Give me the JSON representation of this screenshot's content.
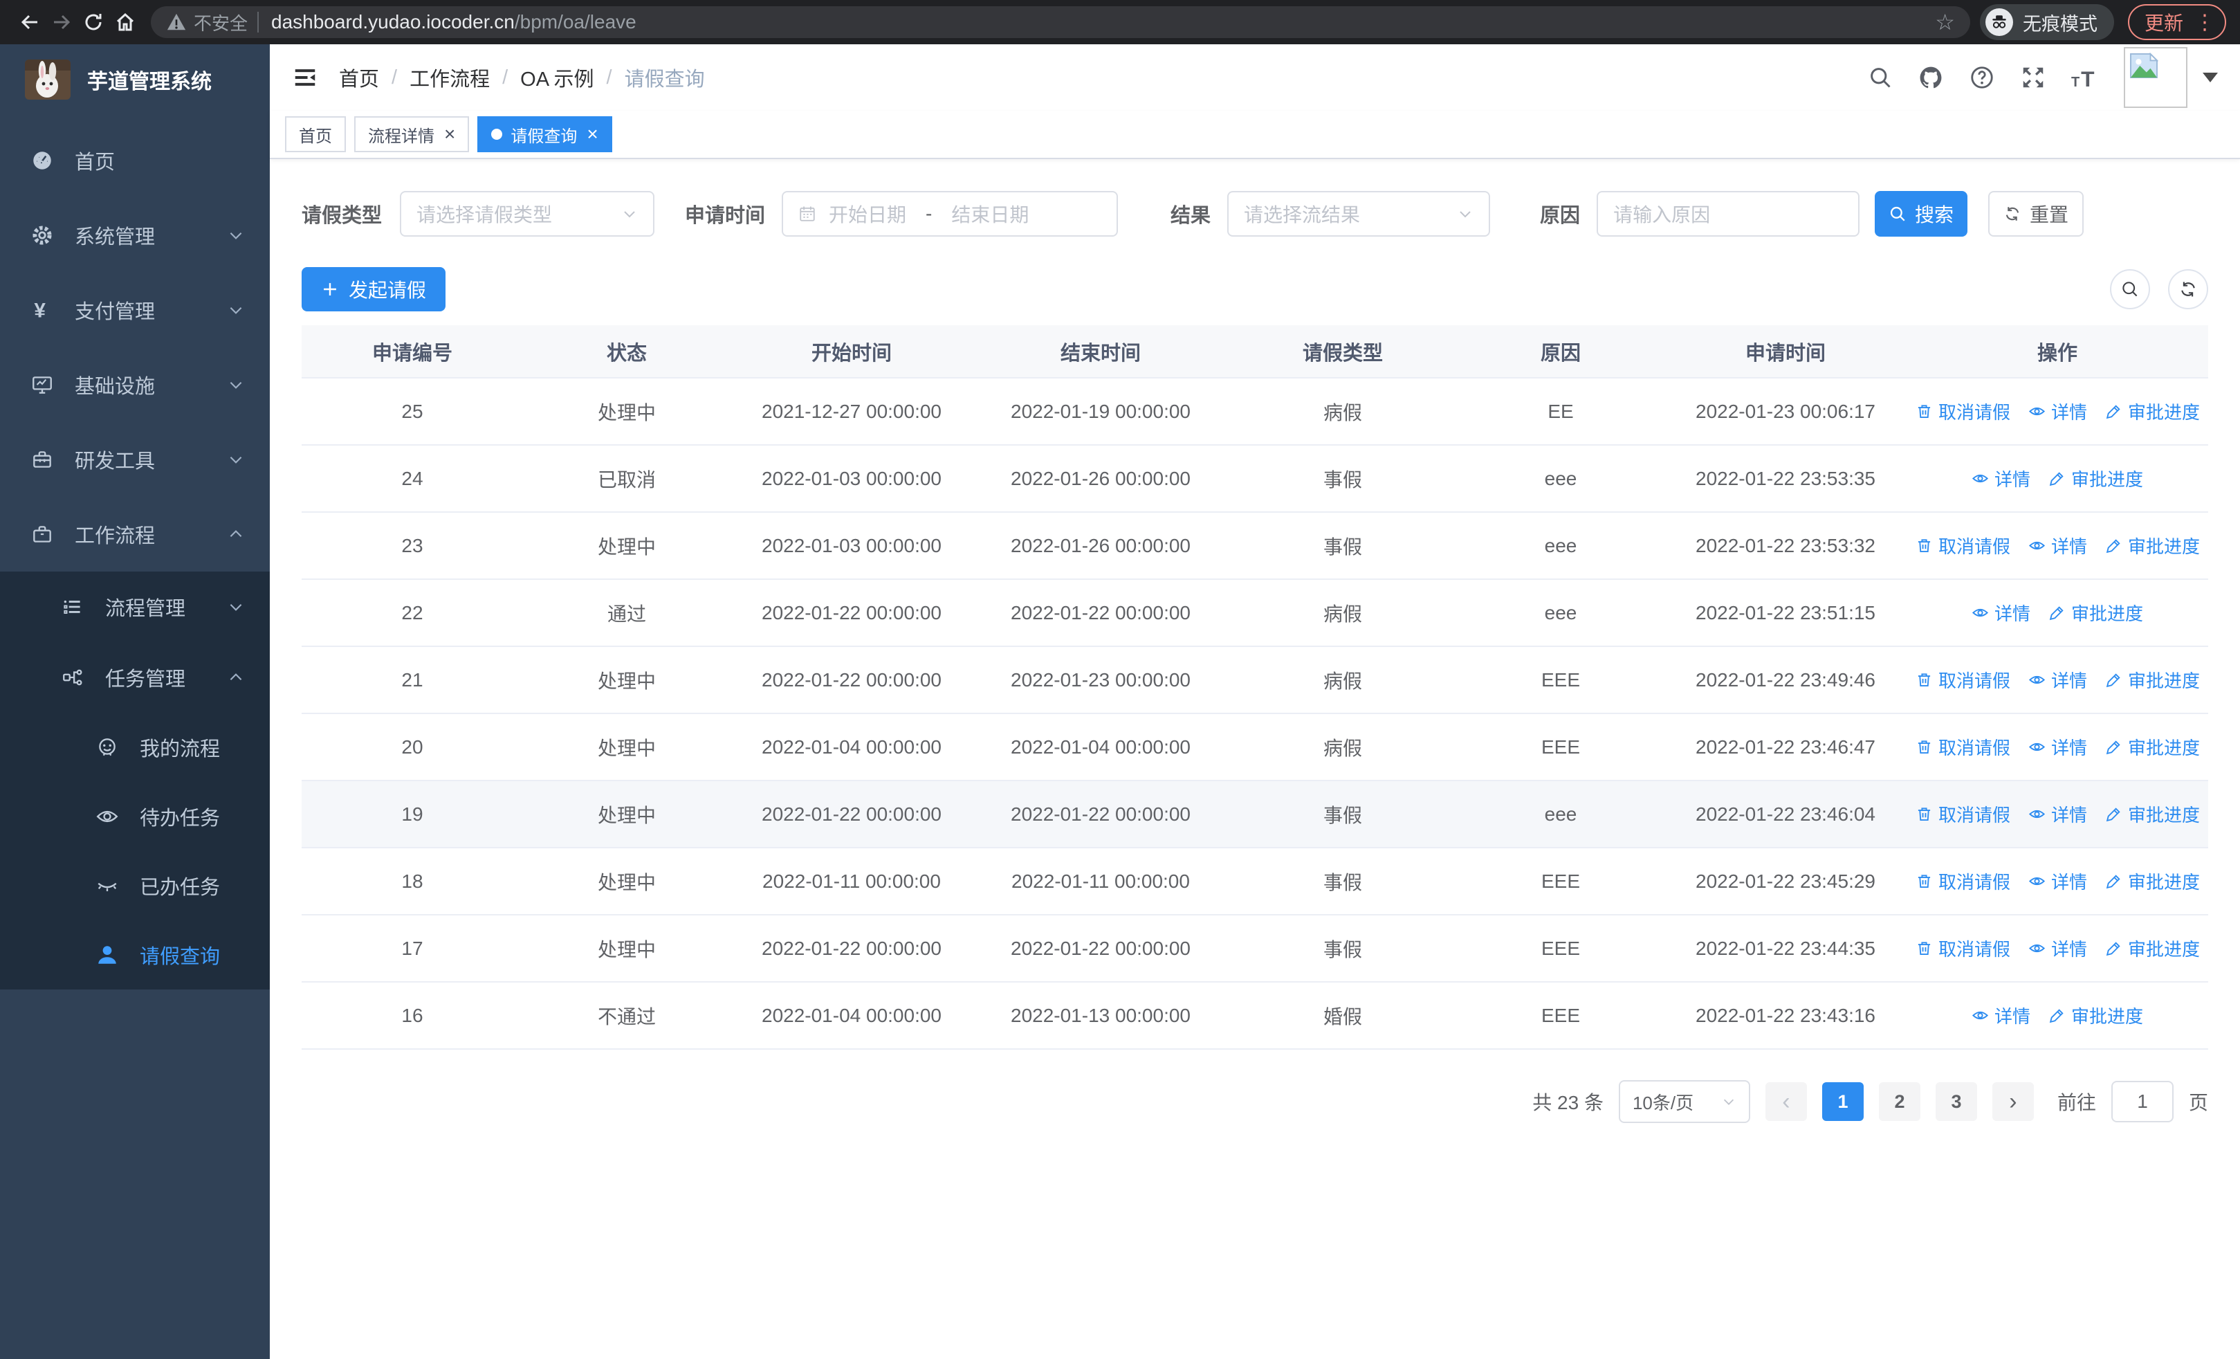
{
  "colors": {
    "primary": "#2d8cf0",
    "sidebar_bg": "#304156",
    "sidebar_sub_bg": "#1f2d3d",
    "sidebar_active": "#409eff",
    "chrome_update": "#f28b82",
    "table_header_bg": "#f7f8fa"
  },
  "browser": {
    "security_label": "不安全",
    "url_host": "dashboard.yudao.iocoder.cn",
    "url_path": "/bpm/oa/leave",
    "incognito_label": "无痕模式",
    "update_label": "更新",
    "menu_dots": "⋮",
    "star": "☆"
  },
  "sidebar": {
    "app_title": "芋道管理系统",
    "items": [
      {
        "label": "首页",
        "icon": "dashboard",
        "level": 1,
        "chev": "",
        "sub": false,
        "active": false
      },
      {
        "label": "系统管理",
        "icon": "gear",
        "level": 1,
        "chev": "down",
        "sub": false,
        "active": false
      },
      {
        "label": "支付管理",
        "icon": "yen",
        "level": 1,
        "chev": "down",
        "sub": false,
        "active": false
      },
      {
        "label": "基础设施",
        "icon": "monitor",
        "level": 1,
        "chev": "down",
        "sub": false,
        "active": false
      },
      {
        "label": "研发工具",
        "icon": "toolbox",
        "level": 1,
        "chev": "down",
        "sub": false,
        "active": false
      },
      {
        "label": "工作流程",
        "icon": "briefcase",
        "level": 1,
        "chev": "up",
        "sub": false,
        "active": false
      },
      {
        "label": "流程管理",
        "icon": "list",
        "level": 2,
        "chev": "down",
        "sub": true,
        "active": false
      },
      {
        "label": "任务管理",
        "icon": "tree",
        "level": 2,
        "chev": "up",
        "sub": true,
        "active": false
      },
      {
        "label": "我的流程",
        "icon": "face",
        "level": 3,
        "chev": "",
        "sub": true,
        "active": false
      },
      {
        "label": "待办任务",
        "icon": "eye-open",
        "level": 3,
        "chev": "",
        "sub": true,
        "active": false
      },
      {
        "label": "已办任务",
        "icon": "eye-closed",
        "level": 3,
        "chev": "",
        "sub": true,
        "active": false
      },
      {
        "label": "请假查询",
        "icon": "user",
        "level": 3,
        "chev": "",
        "sub": true,
        "active": true
      }
    ]
  },
  "header": {
    "breadcrumb": [
      "首页",
      "工作流程",
      "OA 示例",
      "请假查询"
    ]
  },
  "tabs": [
    {
      "label": "首页",
      "closable": false,
      "active": false
    },
    {
      "label": "流程详情",
      "closable": true,
      "active": false
    },
    {
      "label": "请假查询",
      "closable": true,
      "active": true
    }
  ],
  "filters": {
    "leave_type_label": "请假类型",
    "leave_type_placeholder": "请选择请假类型",
    "apply_time_label": "申请时间",
    "date_start_placeholder": "开始日期",
    "date_separator": "-",
    "date_end_placeholder": "结束日期",
    "result_label": "结果",
    "result_placeholder": "请选择流结果",
    "reason_label": "原因",
    "reason_placeholder": "请输入原因",
    "search_label": "搜索",
    "reset_label": "重置"
  },
  "toolbar": {
    "create_label": "发起请假"
  },
  "table": {
    "columns": [
      "申请编号",
      "状态",
      "开始时间",
      "结束时间",
      "请假类型",
      "原因",
      "申请时间",
      "操作"
    ],
    "action_labels": {
      "cancel": "取消请假",
      "detail": "详情",
      "progress": "审批进度"
    },
    "rows": [
      {
        "id": "25",
        "status": "处理中",
        "start": "2021-12-27 00:00:00",
        "end": "2022-01-19 00:00:00",
        "type": "病假",
        "reason": "EE",
        "applied": "2022-01-23 00:06:17",
        "actions": [
          "cancel",
          "detail",
          "progress"
        ],
        "highlight": false
      },
      {
        "id": "24",
        "status": "已取消",
        "start": "2022-01-03 00:00:00",
        "end": "2022-01-26 00:00:00",
        "type": "事假",
        "reason": "eee",
        "applied": "2022-01-22 23:53:35",
        "actions": [
          "detail",
          "progress"
        ],
        "highlight": false
      },
      {
        "id": "23",
        "status": "处理中",
        "start": "2022-01-03 00:00:00",
        "end": "2022-01-26 00:00:00",
        "type": "事假",
        "reason": "eee",
        "applied": "2022-01-22 23:53:32",
        "actions": [
          "cancel",
          "detail",
          "progress"
        ],
        "highlight": false
      },
      {
        "id": "22",
        "status": "通过",
        "start": "2022-01-22 00:00:00",
        "end": "2022-01-22 00:00:00",
        "type": "病假",
        "reason": "eee",
        "applied": "2022-01-22 23:51:15",
        "actions": [
          "detail",
          "progress"
        ],
        "highlight": false
      },
      {
        "id": "21",
        "status": "处理中",
        "start": "2022-01-22 00:00:00",
        "end": "2022-01-23 00:00:00",
        "type": "病假",
        "reason": "EEE",
        "applied": "2022-01-22 23:49:46",
        "actions": [
          "cancel",
          "detail",
          "progress"
        ],
        "highlight": false
      },
      {
        "id": "20",
        "status": "处理中",
        "start": "2022-01-04 00:00:00",
        "end": "2022-01-04 00:00:00",
        "type": "病假",
        "reason": "EEE",
        "applied": "2022-01-22 23:46:47",
        "actions": [
          "cancel",
          "detail",
          "progress"
        ],
        "highlight": false
      },
      {
        "id": "19",
        "status": "处理中",
        "start": "2022-01-22 00:00:00",
        "end": "2022-01-22 00:00:00",
        "type": "事假",
        "reason": "eee",
        "applied": "2022-01-22 23:46:04",
        "actions": [
          "cancel",
          "detail",
          "progress"
        ],
        "highlight": true
      },
      {
        "id": "18",
        "status": "处理中",
        "start": "2022-01-11 00:00:00",
        "end": "2022-01-11 00:00:00",
        "type": "事假",
        "reason": "EEE",
        "applied": "2022-01-22 23:45:29",
        "actions": [
          "cancel",
          "detail",
          "progress"
        ],
        "highlight": false
      },
      {
        "id": "17",
        "status": "处理中",
        "start": "2022-01-22 00:00:00",
        "end": "2022-01-22 00:00:00",
        "type": "事假",
        "reason": "EEE",
        "applied": "2022-01-22 23:44:35",
        "actions": [
          "cancel",
          "detail",
          "progress"
        ],
        "highlight": false
      },
      {
        "id": "16",
        "status": "不通过",
        "start": "2022-01-04 00:00:00",
        "end": "2022-01-13 00:00:00",
        "type": "婚假",
        "reason": "EEE",
        "applied": "2022-01-22 23:43:16",
        "actions": [
          "detail",
          "progress"
        ],
        "highlight": false
      }
    ]
  },
  "pagination": {
    "total_label": "共 23 条",
    "page_size_label": "10条/页",
    "pages": [
      "1",
      "2",
      "3"
    ],
    "active_page": "1",
    "prev": "‹",
    "next": "›",
    "goto_label": "前往",
    "goto_value": "1",
    "page_suffix": "页"
  }
}
